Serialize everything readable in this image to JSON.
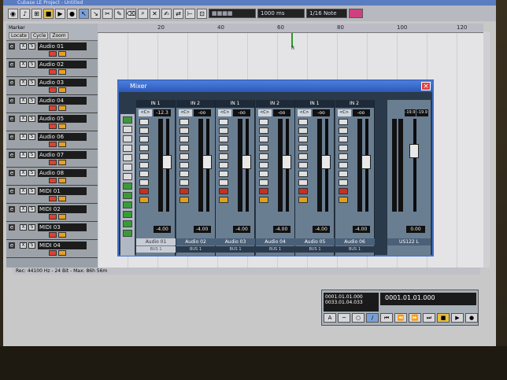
{
  "window": {
    "title": "Cubase LE Project - Untitled"
  },
  "toolbar": {
    "zoom_field": "1000 ms",
    "quant_field": "1/16 Note"
  },
  "ruler": {
    "marks": [
      "20",
      "40",
      "60",
      "80",
      "100",
      "120"
    ],
    "cursor": "R"
  },
  "marker": {
    "label": "Marker",
    "locate": "Locate",
    "cycle": "Cycle",
    "zoom": "Zoom"
  },
  "tracks": [
    {
      "name": "Audio 01"
    },
    {
      "name": "Audio 02"
    },
    {
      "name": "Audio 03"
    },
    {
      "name": "Audio 04"
    },
    {
      "name": "Audio 05"
    },
    {
      "name": "Audio 06"
    },
    {
      "name": "Audio 07"
    },
    {
      "name": "Audio 08"
    },
    {
      "name": "MIDI 01"
    },
    {
      "name": "MIDI 02"
    },
    {
      "name": "MIDI 03"
    },
    {
      "name": "MIDI 04"
    }
  ],
  "status": "Rec: 44100 Hz - 24 Bit - Max: 86h 56m",
  "mixer": {
    "title": "Mixer",
    "channels": [
      {
        "input": "IN 1",
        "vol": "-12.3",
        "fader": "-4.00",
        "name": "Audio 01",
        "bus": "BUS 1"
      },
      {
        "input": "IN 2",
        "vol": "-oo",
        "fader": "-4.00",
        "name": "Audio 02",
        "bus": "BUS 1"
      },
      {
        "input": "IN 1",
        "vol": "-oo",
        "fader": "-4.00",
        "name": "Audio 03",
        "bus": "BUS 1"
      },
      {
        "input": "IN 2",
        "vol": "-oo",
        "fader": "-4.00",
        "name": "Audio 04",
        "bus": "BUS 1"
      },
      {
        "input": "IN 1",
        "vol": "-oo",
        "fader": "-4.00",
        "name": "Audio 05",
        "bus": "BUS 1"
      },
      {
        "input": "IN 2",
        "vol": "-oo",
        "fader": "-4.00",
        "name": "Audio 06",
        "bus": "BUS 1"
      }
    ],
    "master": {
      "vol_l": "-19.9",
      "vol_r": "-19.9",
      "fader": "0.00",
      "name": "US122 L"
    }
  },
  "transport": {
    "left": "0001.01.01.000",
    "right": "0033.01.04.033",
    "position": "0001.01.01.000"
  }
}
